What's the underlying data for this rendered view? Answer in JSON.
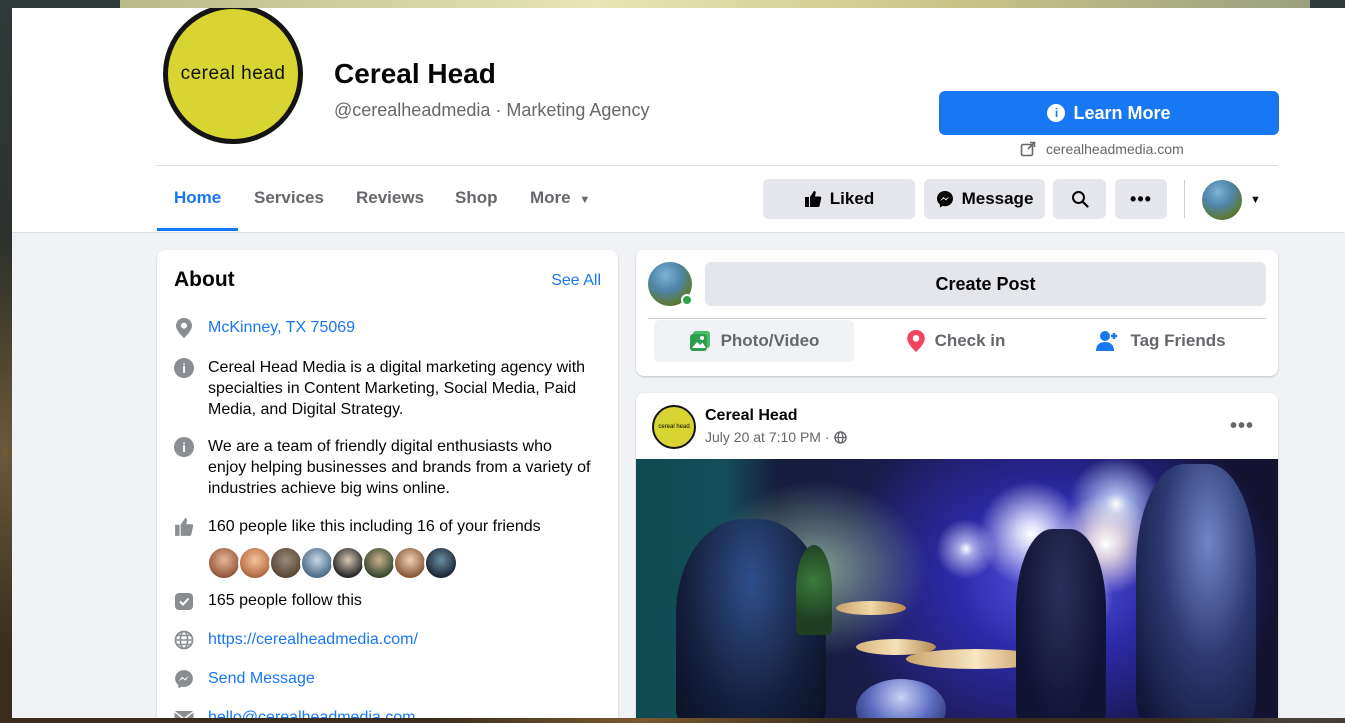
{
  "page": {
    "logo_text": "cereal head",
    "name": "Cereal Head",
    "handle_category": "@cerealheadmedia · Marketing Agency",
    "cta_label": "Learn More",
    "website_short": "cerealheadmedia.com"
  },
  "nav": {
    "tabs": [
      "Home",
      "Services",
      "Reviews",
      "Shop",
      "More"
    ],
    "active_tab": "Home",
    "actions": {
      "liked": "Liked",
      "message": "Message"
    }
  },
  "about": {
    "title": "About",
    "see_all": "See All",
    "location": "McKinney, TX 75069",
    "description_1": "Cereal Head Media is a digital marketing agency with specialties in Content Marketing, Social Media, Paid Media, and Digital Strategy.",
    "description_2": "We are a team of friendly digital enthusiasts who enjoy helping businesses and brands from a variety of industries achieve big wins online.",
    "likes": "160 people like this including 16 of your friends",
    "follows": "165 people follow this",
    "website": "https://cerealheadmedia.com/",
    "send_message": "Send Message",
    "email": "hello@cerealheadmedia.com"
  },
  "composer": {
    "create_post": "Create Post",
    "photo_video": "Photo/Video",
    "check_in": "Check in",
    "tag_friends": "Tag Friends"
  },
  "post": {
    "author": "Cereal Head",
    "avatar_text": "cereal head",
    "timestamp": "July 20 at 7:10 PM ·"
  },
  "colors": {
    "brand_blue": "#1877f2",
    "logo_yellow": "#d8d431",
    "page_bg": "#f0f2f5"
  }
}
